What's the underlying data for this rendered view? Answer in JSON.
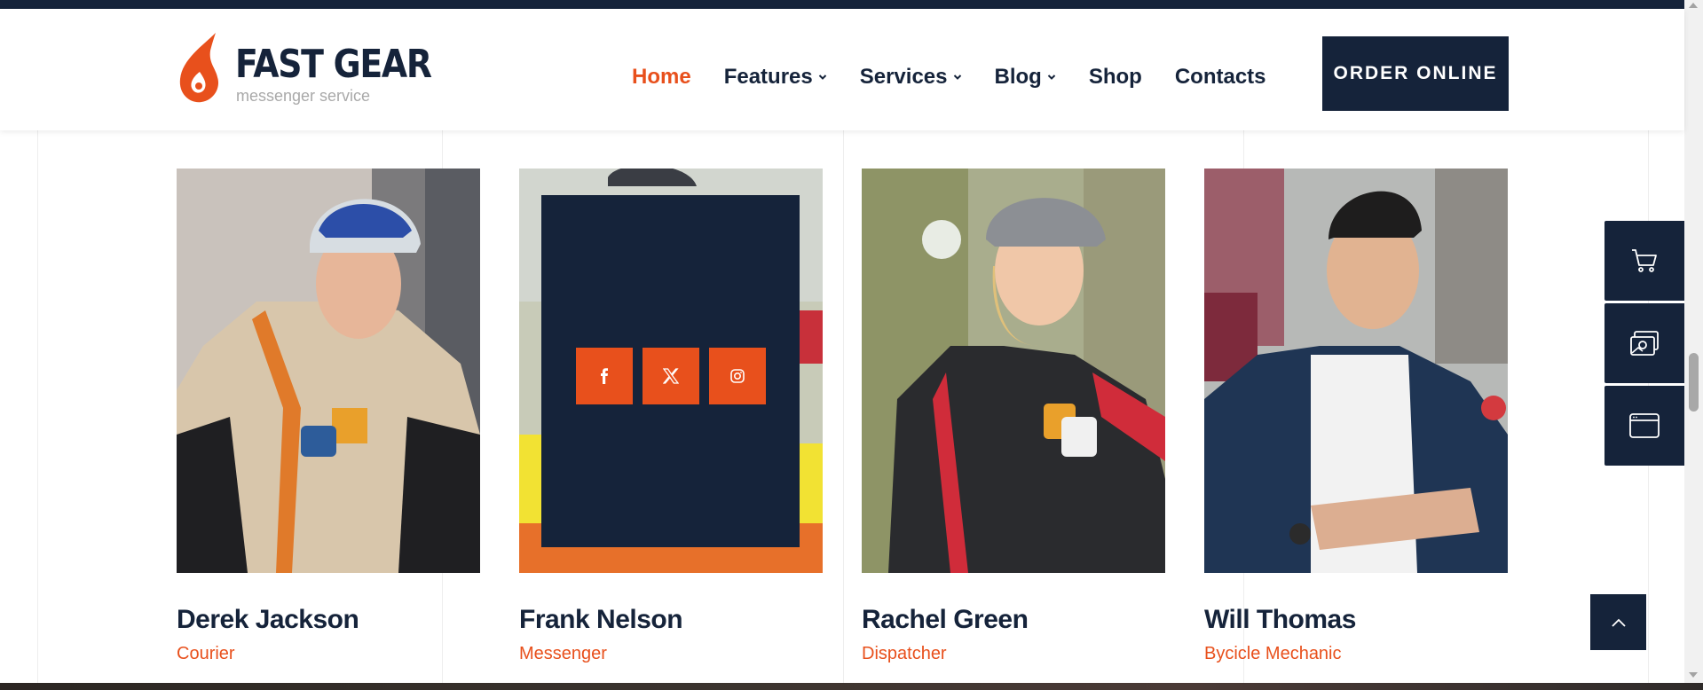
{
  "brand": {
    "name": "FAST GEAR",
    "tagline": "messenger service",
    "accent": "#e8501c",
    "navy": "#15233a"
  },
  "nav": {
    "items": [
      {
        "label": "Home",
        "active": true,
        "dropdown": false
      },
      {
        "label": "Features",
        "active": false,
        "dropdown": true
      },
      {
        "label": "Services",
        "active": false,
        "dropdown": true
      },
      {
        "label": "Blog",
        "active": false,
        "dropdown": true
      },
      {
        "label": "Shop",
        "active": false,
        "dropdown": false
      },
      {
        "label": "Contacts",
        "active": false,
        "dropdown": false
      }
    ],
    "cta_label": "ORDER ONLINE"
  },
  "team": [
    {
      "name": "Derek Jackson",
      "role": "Courier"
    },
    {
      "name": "Frank Nelson",
      "role": "Messenger",
      "hovered": true,
      "socials": [
        "facebook-icon",
        "x-icon",
        "instagram-icon"
      ]
    },
    {
      "name": "Rachel Green",
      "role": "Dispatcher"
    },
    {
      "name": "Will Thomas",
      "role": "Bycicle Mechanic"
    }
  ],
  "side_panel": [
    "cart-icon",
    "gallery-icon",
    "browser-window-icon"
  ],
  "scroll_top_icon": "chevron-up-icon"
}
